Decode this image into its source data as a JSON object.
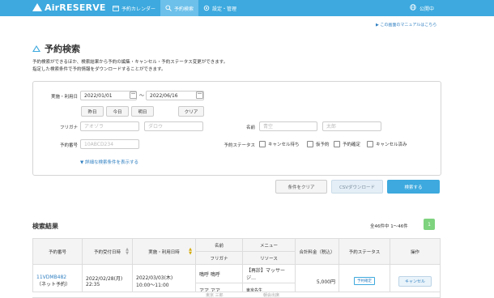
{
  "header": {
    "logo": "AirRESERVE",
    "nav": [
      {
        "label": "予約カレンダー",
        "icon": "calendar-icon",
        "active": false
      },
      {
        "label": "予約検索",
        "icon": "search-icon",
        "active": true
      },
      {
        "label": "設定・管理",
        "icon": "gear-icon",
        "active": false
      }
    ],
    "public_label": "公開中",
    "public_icon": "globe-icon",
    "bar_color": "#3da9de"
  },
  "manual_link": "▶ この画面のマニュアルはこちら",
  "page_title": "予約検索",
  "description": [
    "予約検索ができるほか、検索結果から予約の編集・キャンセル・予約ステータス変更ができます。",
    "指定した検索条件で予約情報をダウンロードすることができます。"
  ],
  "form": {
    "date_label": "実施・利用日",
    "date_from": "2022/01/01",
    "date_sep": "～",
    "date_to": "2022/06/16",
    "quick": [
      "昨日",
      "今日",
      "明日"
    ],
    "clear_label": "クリア",
    "furigana_label": "フリガナ",
    "furigana_sei_ph": "アオゾラ",
    "furigana_mei_ph": "ダロウ",
    "name_label": "名前",
    "name_sei_ph": "青空",
    "name_mei_ph": "太郎",
    "number_label": "予約番号",
    "number_ph": "10ABCD234",
    "status_label": "予約ステータス",
    "statuses": [
      "キャンセル待ち",
      "仮予約",
      "予約確定",
      "キャンセル済み"
    ],
    "detail_link": "▼ 詳細な検索条件を表示する"
  },
  "actions": {
    "clear": "条件をクリア",
    "csv": "CSVダウンロード",
    "search": "検索する"
  },
  "results": {
    "title": "検索結果",
    "count": "全46件中 1〜46件",
    "page": "1",
    "headers": {
      "number": "予約番号",
      "received": "予約受付日時",
      "date": "実施・利用日時",
      "name": "名前",
      "furigana": "フリガナ",
      "menu": "メニュー",
      "resource": "リソース",
      "total": "合計料金（税込）",
      "status": "予約ステータス",
      "ops": "操作"
    },
    "rows": [
      {
        "number": "11VDMB482",
        "channel": "（ネット予約）",
        "received": "2022/02/28(月) 22:35",
        "date": "2022/03/03(木) 10:00〜11:00",
        "name": "鳴呼 鳴呼",
        "furigana": "アア アア",
        "menu": "【再診】マッサージ…",
        "resource": "東京先生",
        "total": "5,000円",
        "status": "予約確定",
        "op": "キャンセル"
      }
    ],
    "next_row_partial": [
      "東京 三郎",
      "朝会出席"
    ]
  }
}
